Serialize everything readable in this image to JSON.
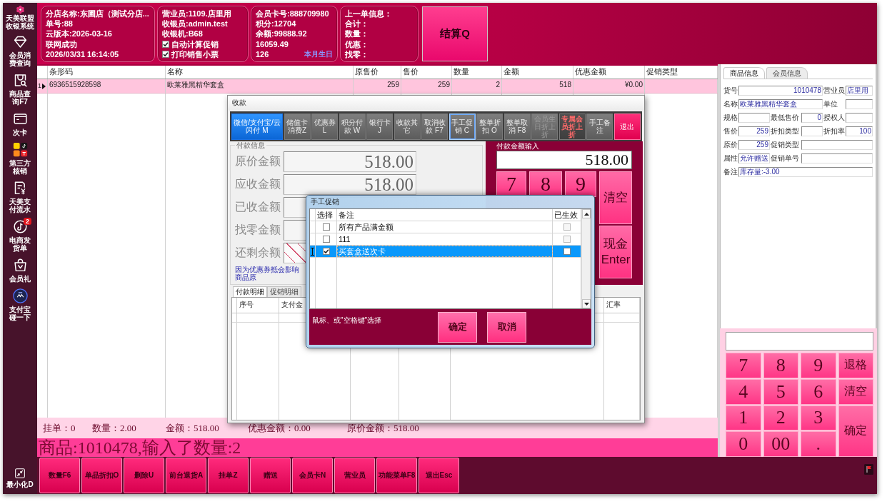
{
  "sidebar": {
    "logo": [
      "天美联盟",
      "收银系统"
    ],
    "items": [
      {
        "kind": "diamond",
        "label": "会员消费查询"
      },
      {
        "kind": "bag-search",
        "label": "商品查询F7"
      },
      {
        "kind": "card",
        "label": "次卡"
      },
      {
        "kind": "apps",
        "label": "第三方核销"
      },
      {
        "kind": "receipt",
        "label": "天美支付流水"
      },
      {
        "kind": "music",
        "label": "电商发货单",
        "badge": "2"
      },
      {
        "kind": "gift-bag",
        "label": "会员礼"
      },
      {
        "kind": "tap",
        "label": "支付宝碰一下"
      }
    ],
    "minimize": "最小化D"
  },
  "header": {
    "store": [
      "分店名称:东圃店（测试分店...",
      "单号:88",
      "云版本:2026-03-16",
      "联网成功",
      "2026/03/31 16:14:05"
    ],
    "staff": {
      "lines": [
        "营业员:1109.店里用",
        "收银员:admin.test",
        "收银机:B68"
      ],
      "options": [
        {
          "label": "自动计算促销",
          "checked": true
        },
        {
          "label": "打印销售小票",
          "checked": true
        }
      ]
    },
    "member": {
      "lines": [
        "会员卡号:888709980",
        "积分:12704",
        "余额:99888.92",
        "16059.49",
        "126"
      ],
      "birthday": "本月生日"
    },
    "last_order": [
      "上一单信息：",
      "合计：",
      "数量：",
      "优惠：",
      "找零："
    ],
    "checkout_button": "结算Q"
  },
  "sales_table": {
    "columns": [
      "条形码",
      "名称",
      "原售价",
      "售价",
      "数量",
      "金额",
      "优惠金额",
      "促销类型"
    ],
    "rows": [
      {
        "index": "1",
        "selected": true,
        "cells": [
          "6936515928598",
          "欧莱雅黑精华套盒",
          "259",
          "259",
          "2",
          "518",
          "¥0.00"
        ]
      }
    ]
  },
  "summary": [
    "挂单：0",
    "数量：2.00",
    "金额：518.00",
    "优惠金额：0.00",
    "原价金额：518.00"
  ],
  "message": "商品:1010478,输入了数量:2",
  "function_buttons": [
    "数量F6",
    "单品折扣O",
    "删除U",
    "前台退货A",
    "挂单Z",
    "赠送",
    "会员卡N",
    "营业员",
    "功能菜单F8",
    "退出Esc"
  ],
  "product_info": {
    "tabs": [
      {
        "label": "商品信息",
        "selected": true
      },
      {
        "label": "会员信息",
        "selected": false
      }
    ],
    "fields": [
      {
        "label": "货号",
        "value": "1010478"
      },
      {
        "label": "营业员",
        "value": "店里用"
      },
      {
        "label": "名称",
        "value": "欧莱雅黑精华套盒"
      },
      {
        "label": "单位"
      },
      {
        "label": "规格"
      },
      {
        "label": "最低售价",
        "value": "0"
      },
      {
        "label": "授权人"
      },
      {
        "label": "售价",
        "value": "259"
      },
      {
        "label": "折扣类型"
      },
      {
        "label": "折扣率",
        "value": "100"
      },
      {
        "label": "原价",
        "value": "259"
      },
      {
        "label": "促销类型"
      },
      {
        "label": "属性",
        "value": "允许赠送"
      },
      {
        "label": "促销单号"
      },
      {
        "label": "备注",
        "value": "库存量:-3.00"
      }
    ]
  },
  "keypad": {
    "keys": [
      {
        "kind": "digit",
        "label": "7"
      },
      {
        "kind": "digit",
        "label": "8"
      },
      {
        "kind": "digit",
        "label": "9"
      },
      {
        "kind": "action",
        "label": "退格"
      },
      {
        "kind": "digit",
        "label": "4"
      },
      {
        "kind": "digit",
        "label": "5"
      },
      {
        "kind": "digit",
        "label": "6"
      },
      {
        "kind": "action",
        "label": "清空"
      },
      {
        "kind": "digit",
        "label": "1"
      },
      {
        "kind": "digit",
        "label": "2"
      },
      {
        "kind": "digit",
        "label": "3"
      },
      {
        "kind": "enter",
        "label": "确定"
      },
      {
        "kind": "digit",
        "label": "0"
      },
      {
        "kind": "digit",
        "label": "00"
      },
      {
        "kind": "digit",
        "label": "."
      }
    ]
  },
  "payment_dialog": {
    "title": "收款",
    "methods": [
      {
        "kind": "method",
        "label": "微信/支付宝/云闪付 M",
        "selected": true,
        "focused": false,
        "disabled": false
      },
      {
        "kind": "method",
        "label": "储值卡消费Z",
        "selected": false,
        "focused": false,
        "disabled": false
      },
      {
        "kind": "method",
        "label": "优惠券L",
        "selected": false,
        "focused": false,
        "disabled": false
      },
      {
        "kind": "method",
        "label": "积分付款 W",
        "selected": false,
        "focused": false,
        "disabled": false
      },
      {
        "kind": "method",
        "label": "银行卡J",
        "selected": false,
        "focused": false,
        "disabled": false
      },
      {
        "kind": "method",
        "label": "收款其它",
        "selected": false,
        "focused": false,
        "disabled": false
      },
      {
        "kind": "method",
        "label": "取消收款 F7",
        "selected": false,
        "focused": false,
        "disabled": false
      },
      {
        "kind": "method",
        "label": "手工促销 C",
        "selected": false,
        "focused": true,
        "disabled": false
      },
      {
        "kind": "method",
        "label": "整单折扣 O",
        "selected": false,
        "focused": false,
        "disabled": false
      },
      {
        "kind": "method",
        "label": "整单取消 F8",
        "selected": false,
        "focused": false,
        "disabled": false
      },
      {
        "kind": "method",
        "label": "会员生日折上折",
        "selected": false,
        "focused": false,
        "disabled": true
      },
      {
        "kind": "warning",
        "label": "专属会员折上折",
        "selected": false,
        "focused": false,
        "disabled": false
      },
      {
        "kind": "method",
        "label": "手工备注",
        "selected": false,
        "focused": false,
        "disabled": false
      },
      {
        "kind": "exit",
        "label": "退出",
        "selected": false,
        "focused": false,
        "disabled": false
      }
    ],
    "group_title": "付款信息",
    "amounts": [
      {
        "kind": "plain",
        "label": "原价金额",
        "value": "518.00"
      },
      {
        "kind": "plain",
        "label": "应收金额",
        "value": "518.00"
      },
      {
        "kind": "plain",
        "label": "已收金额"
      },
      {
        "kind": "plain",
        "label": "找零金额"
      },
      {
        "kind": "hatched",
        "label": "还剩余额"
      }
    ],
    "note": "因为优惠券抵会影响商品原",
    "entry_label": "付款金额输入",
    "entry_value": "518.00",
    "entry_keys": [
      {
        "kind": "digit",
        "label": "7"
      },
      {
        "kind": "digit",
        "label": "8"
      },
      {
        "kind": "digit",
        "label": "9"
      },
      {
        "kind": "action",
        "label": "清空"
      },
      {
        "kind": "action",
        "label": "现金 Enter"
      }
    ],
    "detail_tabs": [
      {
        "label": "付款明细",
        "selected": true
      },
      {
        "label": "促销明细",
        "selected": false
      }
    ],
    "detail_columns": [
      "序号",
      "支付金",
      "汇率"
    ]
  },
  "promo_dialog": {
    "title": "手工促销",
    "columns": [
      "选择",
      "备注",
      "已生效"
    ],
    "rows": [
      {
        "selected": false,
        "checked": false,
        "note": "所有产品满金额",
        "effective": false
      },
      {
        "selected": false,
        "checked": false,
        "note": "111",
        "effective": false
      },
      {
        "selected": true,
        "checked": true,
        "note": "买套盒送次卡",
        "effective": false
      }
    ],
    "hint": "鼠标、或\"空格键\"选择",
    "buttons": [
      "确定",
      "取消"
    ]
  }
}
